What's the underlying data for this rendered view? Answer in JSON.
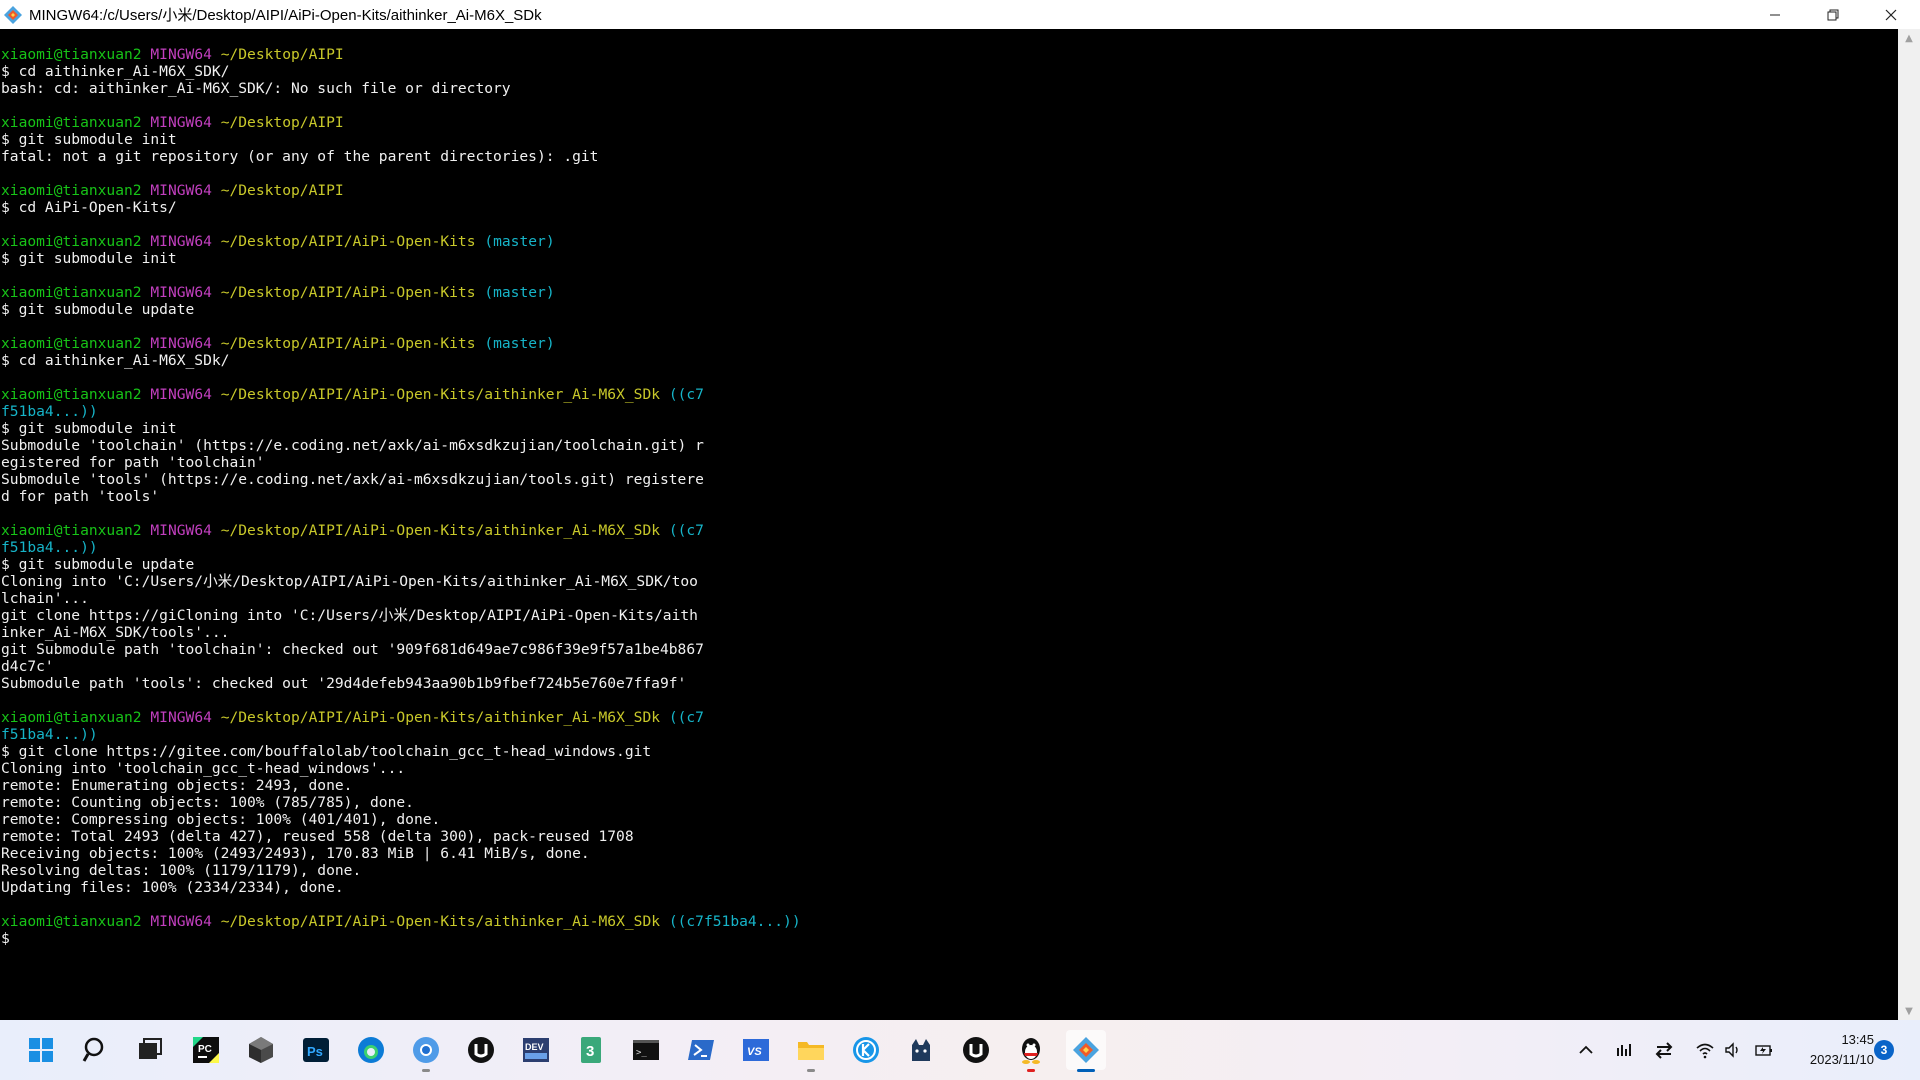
{
  "window": {
    "title": "MINGW64:/c/Users/小米/Desktop/AIPI/AiPi-Open-Kits/aithinker_Ai-M6X_SDk",
    "controls": [
      "minimize",
      "restore",
      "close"
    ]
  },
  "terminal": {
    "colors": {
      "user": "#17c317",
      "shell": "#c13fbe",
      "path": "#c8c82a",
      "branch": "#16b4c8",
      "text": "#f0f0f0"
    },
    "lines": [
      [
        {
          "t": "xiaomi@tianxuan2",
          "c": "green"
        },
        {
          "t": " "
        },
        {
          "t": "MINGW64",
          "c": "mag"
        },
        {
          "t": " "
        },
        {
          "t": "~/Desktop/AIPI",
          "c": "yel"
        }
      ],
      [
        {
          "t": "$ cd aithinker_Ai-M6X_SDK/"
        }
      ],
      [
        {
          "t": "bash: cd: aithinker_Ai-M6X_SDK/: No such file or directory"
        }
      ],
      [],
      [
        {
          "t": "xiaomi@tianxuan2",
          "c": "green"
        },
        {
          "t": " "
        },
        {
          "t": "MINGW64",
          "c": "mag"
        },
        {
          "t": " "
        },
        {
          "t": "~/Desktop/AIPI",
          "c": "yel"
        }
      ],
      [
        {
          "t": "$ git submodule init"
        }
      ],
      [
        {
          "t": "fatal: not a git repository (or any of the parent directories): .git"
        }
      ],
      [],
      [
        {
          "t": "xiaomi@tianxuan2",
          "c": "green"
        },
        {
          "t": " "
        },
        {
          "t": "MINGW64",
          "c": "mag"
        },
        {
          "t": " "
        },
        {
          "t": "~/Desktop/AIPI",
          "c": "yel"
        }
      ],
      [
        {
          "t": "$ cd AiPi-Open-Kits/"
        }
      ],
      [],
      [
        {
          "t": "xiaomi@tianxuan2",
          "c": "green"
        },
        {
          "t": " "
        },
        {
          "t": "MINGW64",
          "c": "mag"
        },
        {
          "t": " "
        },
        {
          "t": "~/Desktop/AIPI/AiPi-Open-Kits",
          "c": "yel"
        },
        {
          "t": " "
        },
        {
          "t": "(master)",
          "c": "cyan"
        }
      ],
      [
        {
          "t": "$ git submodule init"
        }
      ],
      [],
      [
        {
          "t": "xiaomi@tianxuan2",
          "c": "green"
        },
        {
          "t": " "
        },
        {
          "t": "MINGW64",
          "c": "mag"
        },
        {
          "t": " "
        },
        {
          "t": "~/Desktop/AIPI/AiPi-Open-Kits",
          "c": "yel"
        },
        {
          "t": " "
        },
        {
          "t": "(master)",
          "c": "cyan"
        }
      ],
      [
        {
          "t": "$ git submodule update"
        }
      ],
      [],
      [
        {
          "t": "xiaomi@tianxuan2",
          "c": "green"
        },
        {
          "t": " "
        },
        {
          "t": "MINGW64",
          "c": "mag"
        },
        {
          "t": " "
        },
        {
          "t": "~/Desktop/AIPI/AiPi-Open-Kits",
          "c": "yel"
        },
        {
          "t": " "
        },
        {
          "t": "(master)",
          "c": "cyan"
        }
      ],
      [
        {
          "t": "$ cd aithinker_Ai-M6X_SDk/"
        }
      ],
      [],
      [
        {
          "t": "xiaomi@tianxuan2",
          "c": "green"
        },
        {
          "t": " "
        },
        {
          "t": "MINGW64",
          "c": "mag"
        },
        {
          "t": " "
        },
        {
          "t": "~/Desktop/AIPI/AiPi-Open-Kits/aithinker_Ai-M6X_SDk",
          "c": "yel"
        },
        {
          "t": " "
        },
        {
          "t": "((c7",
          "c": "cyan"
        }
      ],
      [
        {
          "t": "f51ba4...))",
          "c": "cyan"
        }
      ],
      [
        {
          "t": "$ git submodule init"
        }
      ],
      [
        {
          "t": "Submodule 'toolchain' (https://e.coding.net/axk/ai-m6xsdkzujian/toolchain.git) r"
        }
      ],
      [
        {
          "t": "egistered for path 'toolchain'"
        }
      ],
      [
        {
          "t": "Submodule 'tools' (https://e.coding.net/axk/ai-m6xsdkzujian/tools.git) registere"
        }
      ],
      [
        {
          "t": "d for path 'tools'"
        }
      ],
      [],
      [
        {
          "t": "xiaomi@tianxuan2",
          "c": "green"
        },
        {
          "t": " "
        },
        {
          "t": "MINGW64",
          "c": "mag"
        },
        {
          "t": " "
        },
        {
          "t": "~/Desktop/AIPI/AiPi-Open-Kits/aithinker_Ai-M6X_SDk",
          "c": "yel"
        },
        {
          "t": " "
        },
        {
          "t": "((c7",
          "c": "cyan"
        }
      ],
      [
        {
          "t": "f51ba4...))",
          "c": "cyan"
        }
      ],
      [
        {
          "t": "$ git submodule update"
        }
      ],
      [
        {
          "t": "Cloning into 'C:/Users/小米/Desktop/AIPI/AiPi-Open-Kits/aithinker_Ai-M6X_SDK/too"
        }
      ],
      [
        {
          "t": "lchain'..."
        }
      ],
      [
        {
          "t": "git clone https://giCloning into 'C:/Users/小米/Desktop/AIPI/AiPi-Open-Kits/aith"
        }
      ],
      [
        {
          "t": "inker_Ai-M6X_SDK/tools'..."
        }
      ],
      [
        {
          "t": "git Submodule path 'toolchain': checked out '909f681d649ae7c986f39e9f57a1be4b867"
        }
      ],
      [
        {
          "t": "d4c7c'"
        }
      ],
      [
        {
          "t": "Submodule path 'tools': checked out '29d4defeb943aa90b1b9fbef724b5e760e7ffa9f'"
        }
      ],
      [],
      [
        {
          "t": "xiaomi@tianxuan2",
          "c": "green"
        },
        {
          "t": " "
        },
        {
          "t": "MINGW64",
          "c": "mag"
        },
        {
          "t": " "
        },
        {
          "t": "~/Desktop/AIPI/AiPi-Open-Kits/aithinker_Ai-M6X_SDk",
          "c": "yel"
        },
        {
          "t": " "
        },
        {
          "t": "((c7",
          "c": "cyan"
        }
      ],
      [
        {
          "t": "f51ba4...))",
          "c": "cyan"
        }
      ],
      [
        {
          "t": "$ git clone https://gitee.com/bouffalolab/toolchain_gcc_t-head_windows.git"
        }
      ],
      [
        {
          "t": "Cloning into 'toolchain_gcc_t-head_windows'..."
        }
      ],
      [
        {
          "t": "remote: Enumerating objects: 2493, done."
        }
      ],
      [
        {
          "t": "remote: Counting objects: 100% (785/785), done."
        }
      ],
      [
        {
          "t": "remote: Compressing objects: 100% (401/401), done."
        }
      ],
      [
        {
          "t": "remote: Total 2493 (delta 427), reused 558 (delta 300), pack-reused 1708"
        }
      ],
      [
        {
          "t": "Receiving objects: 100% (2493/2493), 170.83 MiB | 6.41 MiB/s, done."
        }
      ],
      [
        {
          "t": "Resolving deltas: 100% (1179/1179), done."
        }
      ],
      [
        {
          "t": "Updating files: 100% (2334/2334), done."
        }
      ],
      [],
      [
        {
          "t": "xiaomi@tianxuan2",
          "c": "green"
        },
        {
          "t": " "
        },
        {
          "t": "MINGW64",
          "c": "mag"
        },
        {
          "t": " "
        },
        {
          "t": "~/Desktop/AIPI/AiPi-Open-Kits/aithinker_Ai-M6X_SDk",
          "c": "yel"
        },
        {
          "t": " "
        },
        {
          "t": "((c7f51ba4...))",
          "c": "cyan"
        }
      ],
      [
        {
          "t": "$"
        }
      ]
    ]
  },
  "taskbar": {
    "apps": [
      {
        "name": "start-icon",
        "running": false
      },
      {
        "name": "search-icon",
        "running": false
      },
      {
        "name": "task-view-icon",
        "running": false
      },
      {
        "name": "pycharm-icon",
        "running": false
      },
      {
        "name": "unity-icon",
        "running": false
      },
      {
        "name": "photoshop-icon",
        "running": false
      },
      {
        "name": "edge-icon",
        "running": false
      },
      {
        "name": "chrome-icon",
        "running": true
      },
      {
        "name": "unreal-icon",
        "running": false
      },
      {
        "name": "devcpp-icon",
        "running": false
      },
      {
        "name": "3d-app-icon",
        "running": false
      },
      {
        "name": "cmd-icon",
        "running": false
      },
      {
        "name": "powershell-icon",
        "running": false
      },
      {
        "name": "visual-studio-icon",
        "running": false
      },
      {
        "name": "file-explorer-icon",
        "running": true
      },
      {
        "name": "kugou-icon",
        "running": false
      },
      {
        "name": "cat-app-icon",
        "running": false
      },
      {
        "name": "unreal-engine-icon",
        "running": false
      },
      {
        "name": "qq-icon",
        "running": true
      },
      {
        "name": "git-bash-icon",
        "running": true,
        "active": true
      }
    ],
    "labels": {
      "photoshop": "Ps",
      "devcpp": "DEV",
      "threed": "3",
      "cmd": ">_",
      "vs": "VS"
    },
    "clock": {
      "time": "13:45",
      "date": "2023/11/10"
    },
    "notification_count": "3"
  }
}
